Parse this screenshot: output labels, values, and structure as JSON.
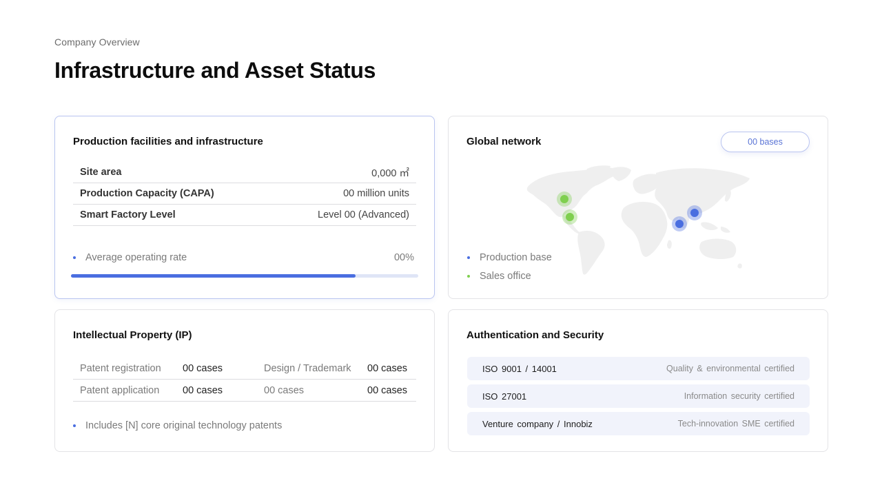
{
  "header": {
    "eyebrow": "Company Overview",
    "title": "Infrastructure and Asset Status"
  },
  "production": {
    "title": "Production facilities and infrastructure",
    "rows": [
      {
        "label": "Site area",
        "value": "0,000 ㎡"
      },
      {
        "label": "Production Capacity (CAPA)",
        "value": "00 million units"
      },
      {
        "label": "Smart Factory Level",
        "value": "Level 00 (Advanced)"
      }
    ],
    "rate_label": "Average operating rate",
    "rate_value": "00%",
    "rate_progress_fraction": 0.82
  },
  "network": {
    "title": "Global network",
    "badge": "00 bases",
    "legend": [
      {
        "label": "Production base",
        "color": "#4a6ee0"
      },
      {
        "label": "Sales office",
        "color": "#7fcf4f"
      }
    ]
  },
  "ip": {
    "title": "Intellectual Property (IP)",
    "rows": [
      {
        "label1": "Patent registration",
        "value1": "00 cases",
        "label2": "Design / Trademark",
        "value2": "00 cases"
      },
      {
        "label1": "Patent application",
        "value1": "00 cases",
        "label2": "00 cases",
        "value2": "00 cases"
      }
    ],
    "note": "Includes [N] core original technology patents"
  },
  "auth": {
    "title": "Authentication and Security",
    "certs": [
      {
        "name": "ISO 9001 / 14001",
        "desc": "Quality & environmental certified"
      },
      {
        "name": "ISO 27001",
        "desc": "Information security certified"
      },
      {
        "name": "Venture company / Innobiz",
        "desc": "Tech-innovation SME certified"
      }
    ]
  },
  "colors": {
    "accent_blue": "#4a6ee0",
    "accent_green": "#7fcf4f",
    "card_border": "#e3e3e6",
    "cert_bg": "#f1f3fb"
  },
  "icons": [
    "world-map-icon"
  ]
}
